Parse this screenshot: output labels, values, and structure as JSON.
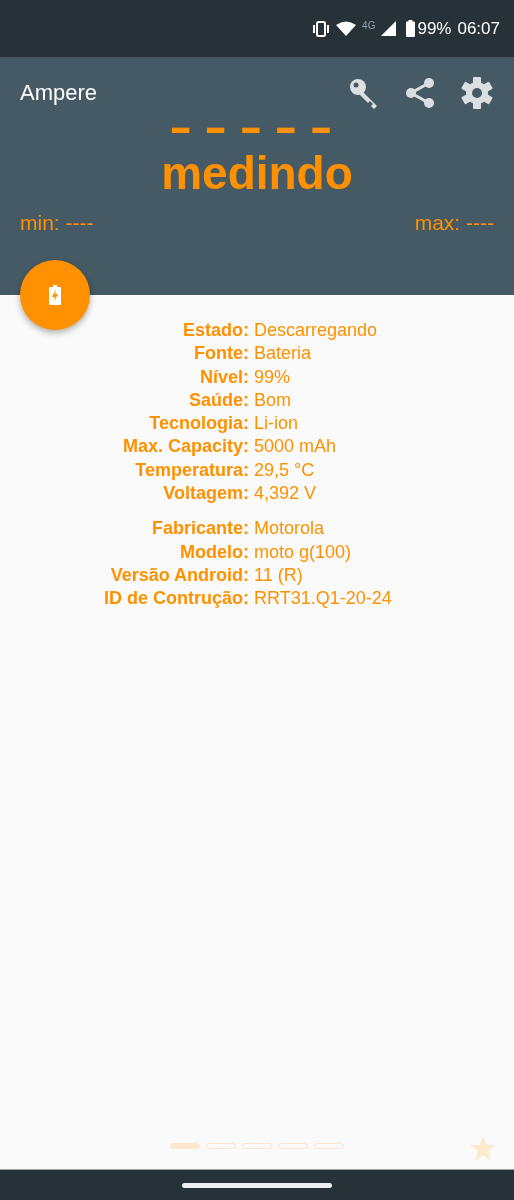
{
  "status_bar": {
    "network": "4G",
    "battery": "99%",
    "time": "06:07"
  },
  "toolbar": {
    "title": "Ampere"
  },
  "reading": {
    "value": "-----",
    "status": "medindo",
    "min": "min: ----",
    "max": "max: ----"
  },
  "info_groups": [
    [
      {
        "label": "Estado:",
        "value": "Descarregando"
      },
      {
        "label": "Fonte:",
        "value": "Bateria"
      },
      {
        "label": "Nível:",
        "value": "99%"
      },
      {
        "label": "Saúde:",
        "value": "Bom"
      },
      {
        "label": "Tecnologia:",
        "value": "Li-ion"
      },
      {
        "label": "Max. Capacity:",
        "value": "5000 mAh"
      },
      {
        "label": "Temperatura:",
        "value": "29,5 °C"
      },
      {
        "label": "Voltagem:",
        "value": "4,392 V"
      }
    ],
    [
      {
        "label": "Fabricante:",
        "value": "Motorola"
      },
      {
        "label": "Modelo:",
        "value": "moto g(100)"
      },
      {
        "label": "Versão Android:",
        "value": "11 (R)"
      },
      {
        "label": "ID de Contrução:",
        "value": "RRT31.Q1-20-24"
      }
    ]
  ],
  "pager": [
    {
      "selected": true
    },
    {
      "selected": false
    },
    {
      "selected": false
    },
    {
      "selected": false
    },
    {
      "selected": false
    }
  ]
}
